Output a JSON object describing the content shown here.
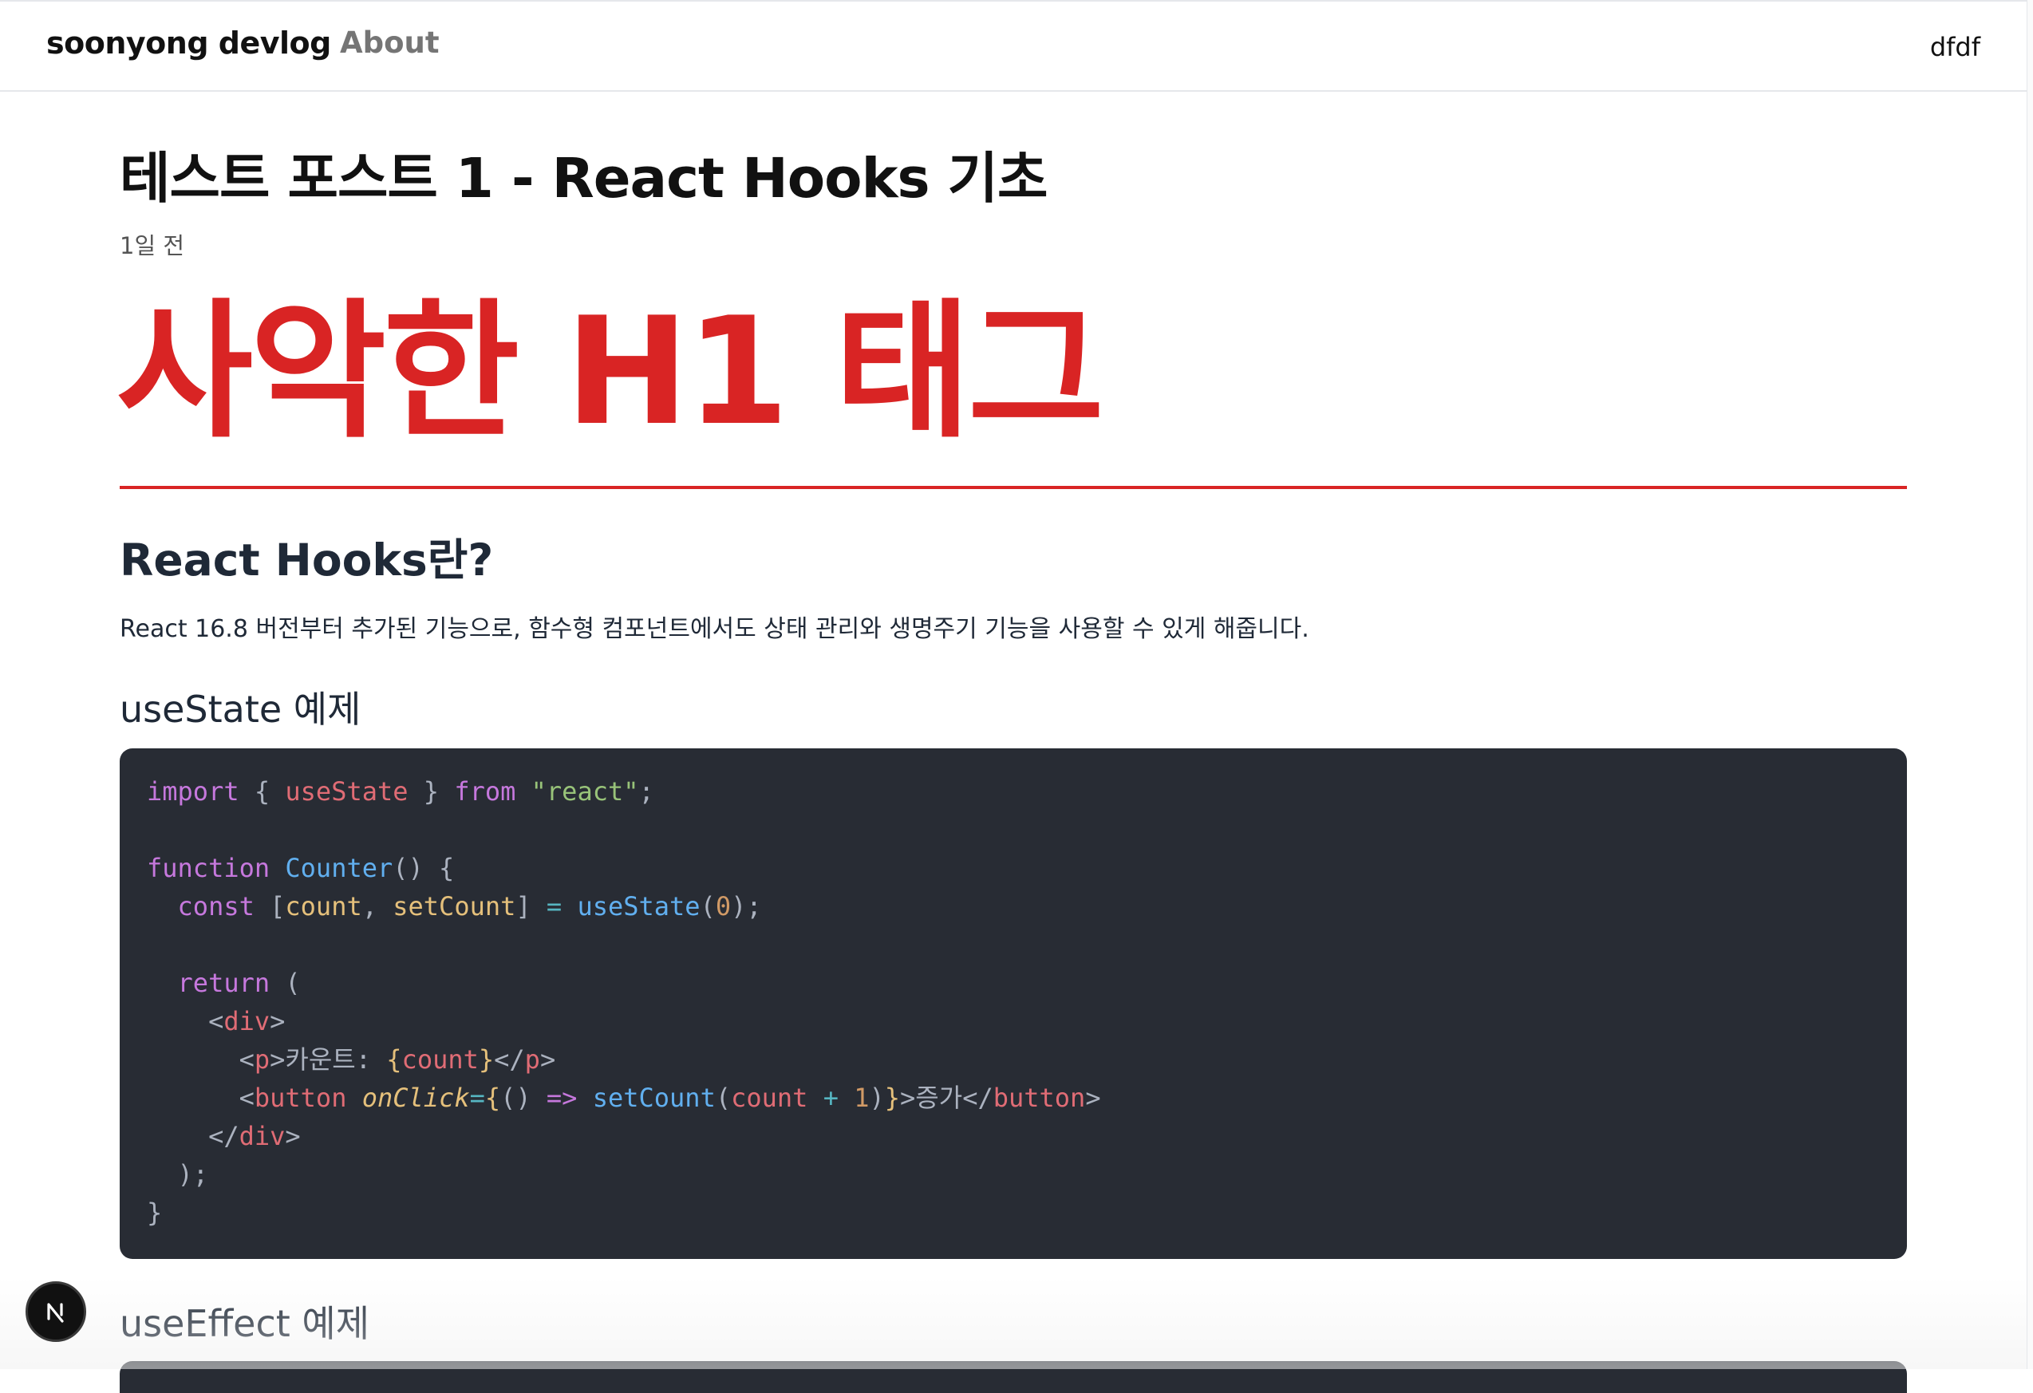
{
  "header": {
    "brand": "soonyong devlog",
    "nav_about": "About",
    "right_text": "dfdf"
  },
  "post": {
    "title": "테스트 포스트 1 - React Hooks 기초",
    "date": "1일 전",
    "big_heading": "사악한 H1 태그",
    "section_heading": "React Hooks란?",
    "paragraph": "React 16.8 버전부터 추가된 기능으로, 함수형 컴포넌트에서도 상태 관리와 생명주기 기능을 사용할 수 있게 해줍니다.",
    "sub_heading_1": "useState 예제",
    "sub_heading_2": "useEffect 예제"
  },
  "code": {
    "language": "jsx",
    "lines": [
      "import { useState } from \"react\";",
      "",
      "function Counter() {",
      "  const [count, setCount] = useState(0);",
      "",
      "  return (",
      "    <div>",
      "      <p>카운트: {count}</p>",
      "      <button onClick={() => setCount(count + 1)}>증가</button>",
      "    </div>",
      "  );",
      "}"
    ]
  },
  "colors": {
    "accent_red": "#d92424",
    "code_bg": "#282c34",
    "keyword": "#c678dd",
    "function": "#61afef",
    "string": "#98c379",
    "variable": "#e5c07b",
    "tag": "#e06c75",
    "number": "#d19a66"
  },
  "icons": {
    "next_badge": "nextjs-logo-icon"
  }
}
